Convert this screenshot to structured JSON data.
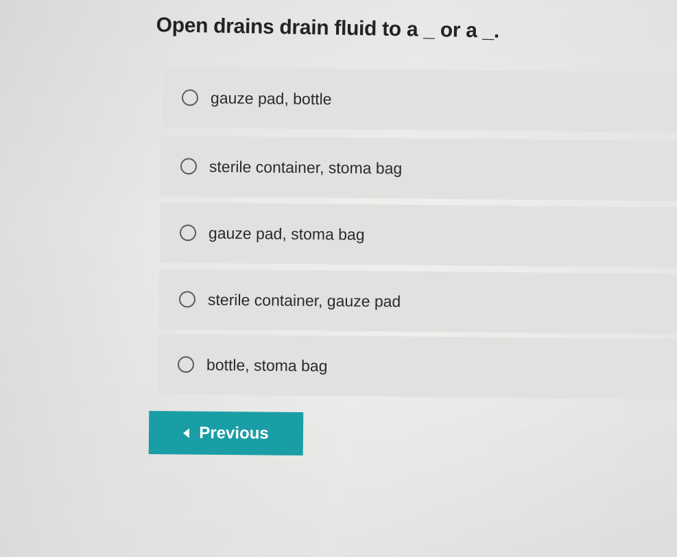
{
  "question": {
    "text": "Open drains drain fluid to a _ or a _."
  },
  "options": [
    {
      "label": "gauze pad, bottle"
    },
    {
      "label": "sterile container, stoma bag"
    },
    {
      "label": "gauze pad, stoma bag"
    },
    {
      "label": "sterile container, gauze pad"
    },
    {
      "label": "bottle, stoma bag"
    }
  ],
  "navigation": {
    "previous_label": "Previous",
    "previous_icon": "caret-left-icon",
    "accent_color": "#1a9ea6"
  },
  "colors": {
    "option_background": "#e1e1df",
    "radio_border": "#5b5b5b"
  }
}
